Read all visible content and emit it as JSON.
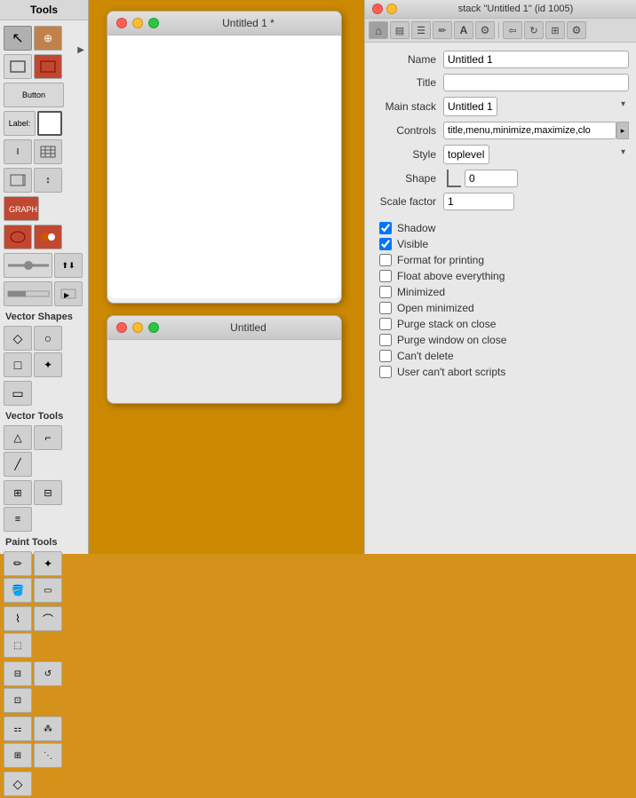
{
  "tools": {
    "title": "Tools",
    "buttons": [
      {
        "id": "arrow",
        "icon": "↖",
        "selected": true
      },
      {
        "id": "move",
        "icon": "⊕",
        "selected": false
      }
    ]
  },
  "canvas": {
    "window1": {
      "title": "Untitled 1 *"
    },
    "window2": {
      "title": "Untitled"
    }
  },
  "props": {
    "title": "stack \"Untitled 1\" (id 1005)",
    "fields": {
      "name_label": "Name",
      "name_value": "Untitled 1",
      "title_label": "Title",
      "title_value": "",
      "main_stack_label": "Main stack",
      "main_stack_value": "Untitled 1",
      "controls_label": "Controls",
      "controls_value": "title,menu,minimize,maximize,clo",
      "style_label": "Style",
      "style_value": "toplevel",
      "shape_label": "Shape",
      "shape_value": "0",
      "scale_factor_label": "Scale factor",
      "scale_factor_value": "1"
    },
    "checkboxes": [
      {
        "id": "shadow",
        "label": "Shadow",
        "checked": true
      },
      {
        "id": "visible",
        "label": "Visible",
        "checked": true
      },
      {
        "id": "format-printing",
        "label": "Format for printing",
        "checked": false
      },
      {
        "id": "float-above",
        "label": "Float above everything",
        "checked": false
      },
      {
        "id": "minimized",
        "label": "Minimized",
        "checked": false
      },
      {
        "id": "open-minimized",
        "label": "Open minimized",
        "checked": false
      },
      {
        "id": "purge-stack",
        "label": "Purge stack on close",
        "checked": false
      },
      {
        "id": "purge-window",
        "label": "Purge window on close",
        "checked": false
      },
      {
        "id": "cant-delete",
        "label": "Can't delete",
        "checked": false
      },
      {
        "id": "user-abort",
        "label": "User can't abort scripts",
        "checked": false
      }
    ]
  },
  "sections": {
    "vector_shapes": "Vector Shapes",
    "vector_tools": "Vector Tools",
    "paint_tools": "Paint Tools"
  }
}
